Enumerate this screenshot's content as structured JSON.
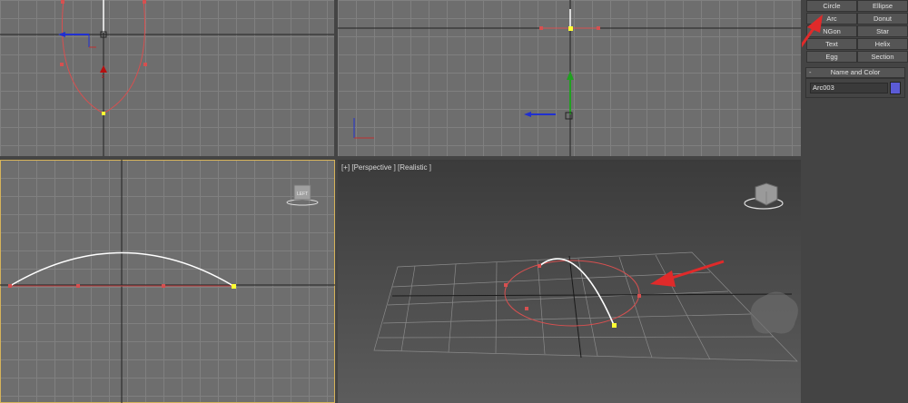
{
  "viewports": {
    "top_left": {
      "label": ""
    },
    "top_right": {
      "label": ""
    },
    "bottom_left": {
      "label": ""
    },
    "perspective": {
      "label": "[+] [Perspective ] [Realistic ]"
    }
  },
  "command_panel": {
    "object_types": [
      "Circle",
      "Ellipse",
      "Arc",
      "Donut",
      "NGon",
      "Star",
      "Text",
      "Helix",
      "Egg",
      "Section"
    ],
    "name_and_color": {
      "header": "Name and Color",
      "collapse_symbol": "-",
      "name_value": "Arc003",
      "color": "#5b5bd6"
    }
  },
  "colors": {
    "spline_red": "#d65050",
    "selected_white": "#ffffff",
    "vertex_yellow": "#ffff33",
    "arrow_red": "#e02a2a"
  }
}
